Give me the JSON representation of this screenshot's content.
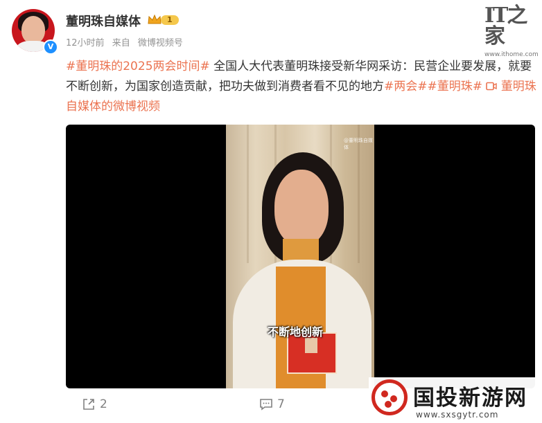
{
  "user": {
    "name": "董明珠自媒体",
    "level": "1",
    "time": "12小时前",
    "source_prefix": "来自",
    "source": "微博视频号",
    "verified_mark": "V"
  },
  "logo": {
    "mark": "IT之家",
    "url": "www.ithome.com"
  },
  "post": {
    "tag1": "#董明珠的2025两会时间#",
    "body": " 全国人大代表董明珠接受新华网采访：民营企业要发展，就要不断创新，为国家创造贡献，把功夫做到消费者看不见的地方",
    "tag2": "#两会#",
    "tag3": "#董明珠#",
    "video_link": "董明珠自媒体的微博视频"
  },
  "video": {
    "subtitle": "不断地创新",
    "watermark": "@董明珠自媒体"
  },
  "actions": {
    "share_count": "2",
    "comment_count": "7"
  },
  "site_watermark": {
    "name": "国投新游网",
    "url": "www.sxsgytr.com"
  },
  "colors": {
    "tag": "#eb7350",
    "level_badge": "#f5c84c",
    "watermark_red": "#d0281f"
  }
}
